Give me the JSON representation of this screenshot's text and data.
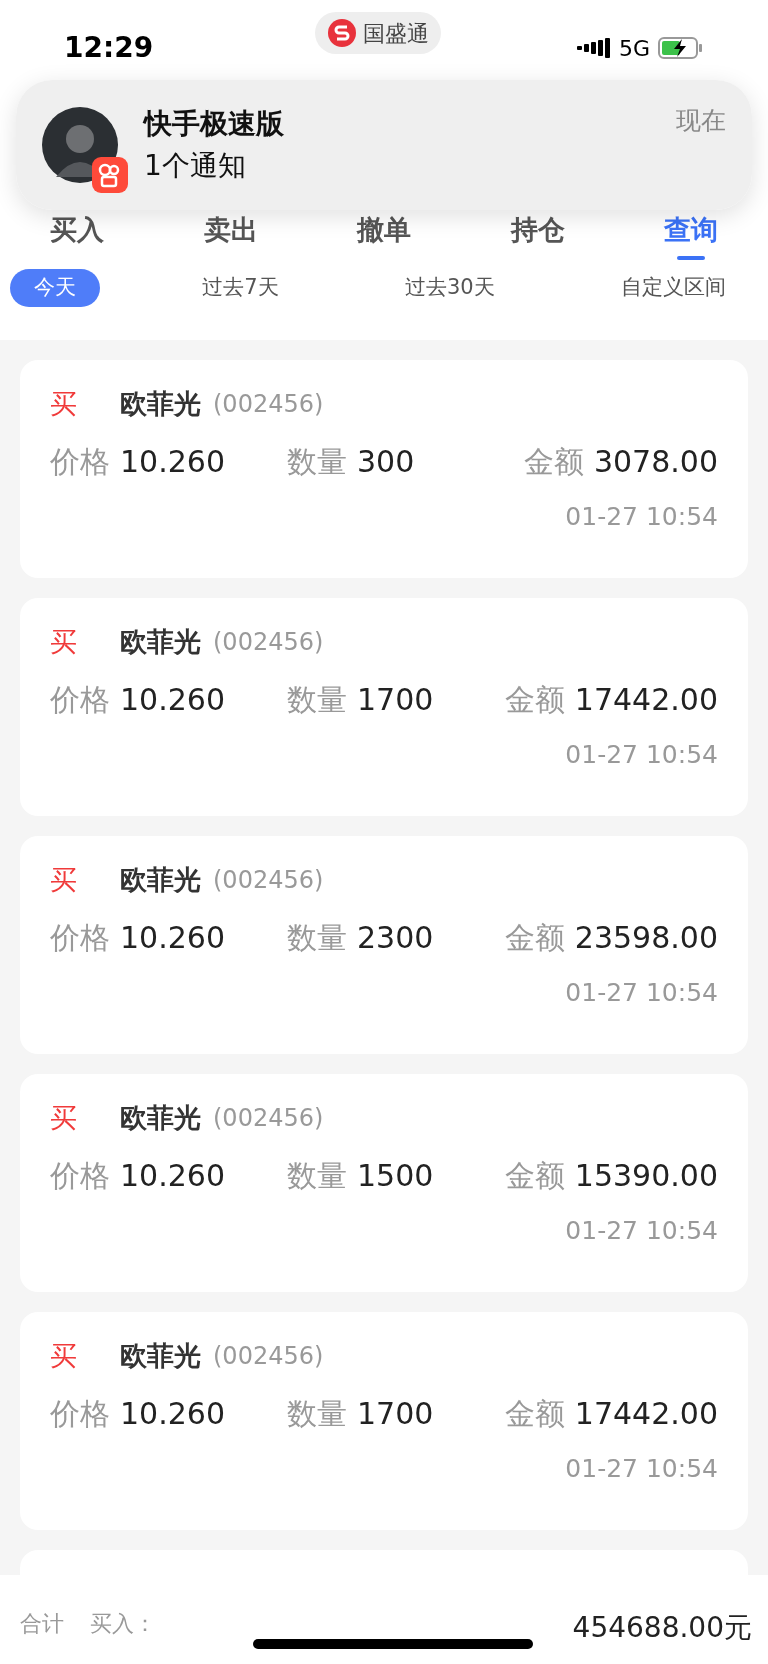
{
  "status_bar": {
    "time": "12:29",
    "network": "5G"
  },
  "app_pill": {
    "name": "国盛通"
  },
  "notification": {
    "app": "快手极速版",
    "message": "1个通知",
    "time": "现在"
  },
  "tabs": [
    {
      "label": "买入",
      "selected": false
    },
    {
      "label": "卖出",
      "selected": false
    },
    {
      "label": "撤单",
      "selected": false
    },
    {
      "label": "持仓",
      "selected": false
    },
    {
      "label": "查询",
      "selected": true
    }
  ],
  "filters": [
    {
      "label": "今天",
      "selected": true
    },
    {
      "label": "过去7天",
      "selected": false
    },
    {
      "label": "过去30天",
      "selected": false
    },
    {
      "label": "自定义区间",
      "selected": false
    }
  ],
  "orders": [
    {
      "kind": "buy",
      "side": "买",
      "name": "欧菲光",
      "code": "(002456)",
      "price_label": "价格",
      "price": "10.260",
      "qty_label": "数量",
      "qty": "300",
      "amount_label": "金额",
      "amount": "3078.00",
      "time": "01-27 10:54"
    },
    {
      "kind": "buy",
      "side": "买",
      "name": "欧菲光",
      "code": "(002456)",
      "price_label": "价格",
      "price": "10.260",
      "qty_label": "数量",
      "qty": "1700",
      "amount_label": "金额",
      "amount": "17442.00",
      "time": "01-27 10:54"
    },
    {
      "kind": "buy",
      "side": "买",
      "name": "欧菲光",
      "code": "(002456)",
      "price_label": "价格",
      "price": "10.260",
      "qty_label": "数量",
      "qty": "2300",
      "amount_label": "金额",
      "amount": "23598.00",
      "time": "01-27 10:54"
    },
    {
      "kind": "buy",
      "side": "买",
      "name": "欧菲光",
      "code": "(002456)",
      "price_label": "价格",
      "price": "10.260",
      "qty_label": "数量",
      "qty": "1500",
      "amount_label": "金额",
      "amount": "15390.00",
      "time": "01-27 10:54"
    },
    {
      "kind": "buy",
      "side": "买",
      "name": "欧菲光",
      "code": "(002456)",
      "price_label": "价格",
      "price": "10.260",
      "qty_label": "数量",
      "qty": "1700",
      "amount_label": "金额",
      "amount": "17442.00",
      "time": "01-27 10:54"
    }
  ],
  "footer": {
    "label": "合计",
    "side_label": "买入：",
    "total": "454688.00元"
  }
}
